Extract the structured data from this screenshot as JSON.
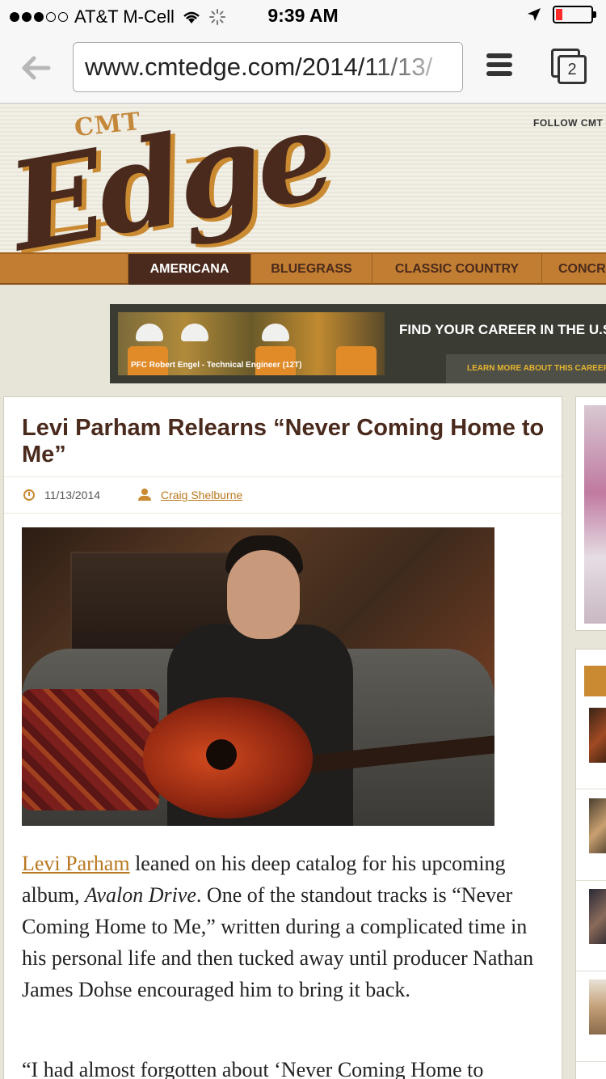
{
  "status": {
    "carrier": "AT&T M-Cell",
    "time": "9:39 AM",
    "battery_level": 0.2
  },
  "browser": {
    "url": "www.cmtedge.com/2014/11/13/",
    "tab_count": "2"
  },
  "site": {
    "logo_top": "CMT",
    "logo_main": "Edge",
    "follow": "FOLLOW  CMT"
  },
  "nav": {
    "items": [
      "AMERICANA",
      "BLUEGRASS",
      "CLASSIC COUNTRY",
      "CONCR"
    ]
  },
  "ad": {
    "caption": "PFC Robert Engel - Technical Engineer (12T)",
    "headline": "FIND YOUR CAREER IN THE U.S",
    "cta": "LEARN MORE ABOUT THIS CAREER"
  },
  "article": {
    "title": "Levi Parham Relearns “Never Coming Home to Me”",
    "date": "11/13/2014",
    "author": "Craig Shelburne",
    "p1_link": "Levi Parham",
    "p1_a": " leaned on his deep catalog for his upcoming album, ",
    "p1_album": "Avalon Drive",
    "p1_b": ". One of the standout tracks is “Never Coming Home to Me,” written during a complicated time in his personal life and then tucked away until producer Nathan James Dohse encouraged him to bring it back.",
    "p2": "“I had almost forgotten about ‘Never Coming Home to"
  },
  "colors": {
    "brand_brown": "#4a2a1c",
    "brand_orange": "#c17d31",
    "link": "#b9781f"
  }
}
